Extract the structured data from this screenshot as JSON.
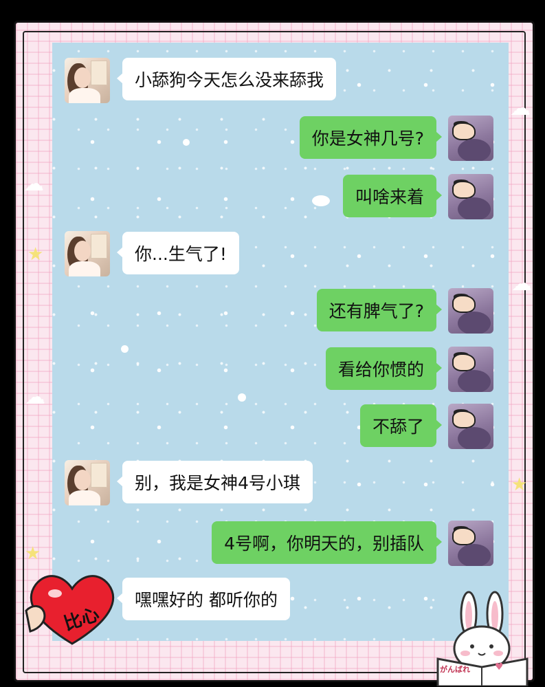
{
  "conversation": {
    "messages": [
      {
        "side": "left",
        "text": "小舔狗今天怎么没来舔我"
      },
      {
        "side": "right",
        "text": "你是女神几号?"
      },
      {
        "side": "right",
        "text": "叫啥来着"
      },
      {
        "side": "left",
        "text": "你...生气了!"
      },
      {
        "side": "right",
        "text": "还有脾气了?"
      },
      {
        "side": "right",
        "text": "看给你惯的"
      },
      {
        "side": "right",
        "text": "不舔了"
      },
      {
        "side": "left",
        "text": "别，我是女神4号小琪"
      },
      {
        "side": "right",
        "text": "4号啊，你明天的，别插队"
      },
      {
        "side": "left",
        "text": "嘿嘿好的 都听你的"
      }
    ]
  },
  "stickers": {
    "heart_text": "比心",
    "book_text": "がんばれ"
  },
  "icons": {
    "girl_avatar": "girl-avatar-icon",
    "crayon_avatar": "crayon-shin-chan-avatar-icon",
    "heart": "heart-hand-icon",
    "bunny": "bunny-reading-icon"
  },
  "colors": {
    "chat_background": "#b9daea",
    "right_bubble": "#6ed163",
    "left_bubble": "#ffffff",
    "frame_pink": "#fbe7ef",
    "heart_red": "#e8202e"
  }
}
